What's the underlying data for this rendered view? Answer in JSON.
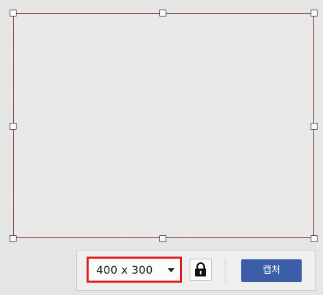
{
  "toolbar": {
    "size_value": "400 x 300",
    "capture_label": "캡처",
    "lock_icon": "lock-icon",
    "dropdown_icon": "caret-down-icon"
  },
  "colors": {
    "region_border": "#7c3a45",
    "highlight": "#e01818",
    "capture_button": "#3c5ea8"
  }
}
